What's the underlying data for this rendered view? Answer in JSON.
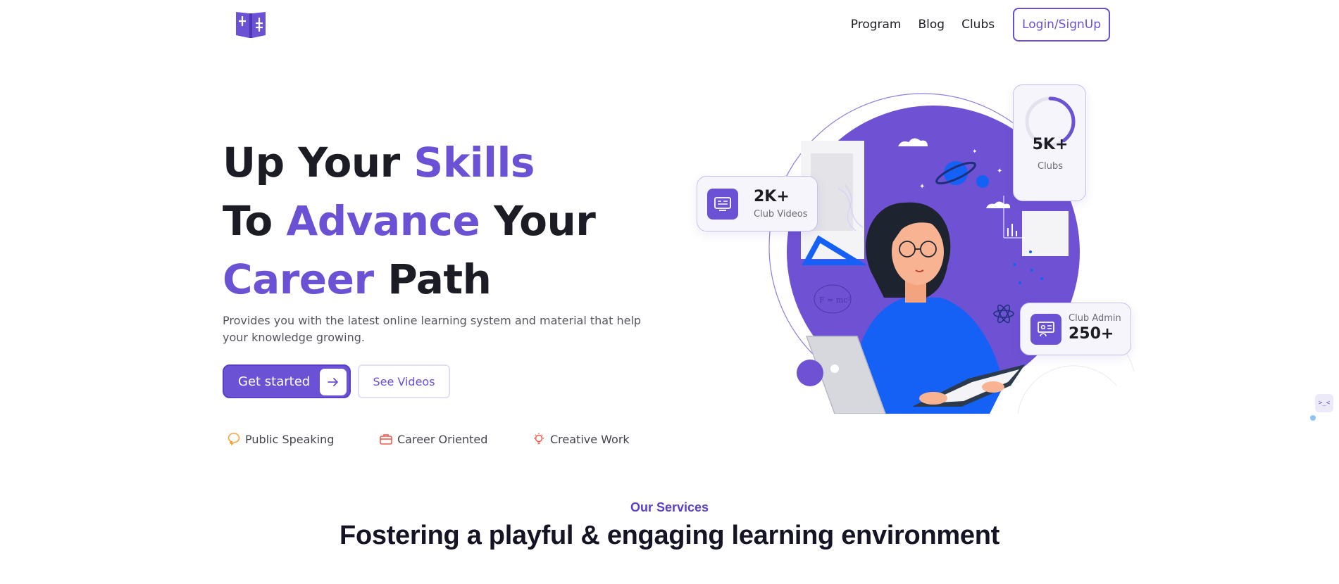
{
  "header": {
    "logo_icon": "open-book-icon",
    "nav": [
      {
        "label": "Program"
      },
      {
        "label": "Blog"
      },
      {
        "label": "Clubs"
      }
    ],
    "login_label": "Login/SignUp"
  },
  "hero": {
    "line1_a": "Up Your ",
    "line1_b": "Skills",
    "line2_a": "To ",
    "line2_b": "Advance",
    "line2_c": " Your",
    "line3_a": "Career",
    "line3_b": " Path",
    "subtext": "Provides you with the latest online learning system and material that help your knowledge growing.",
    "primary_button": "Get started",
    "secondary_button": "See Videos",
    "features": [
      {
        "icon": "speech-bubble-icon",
        "label": "Public Speaking"
      },
      {
        "icon": "briefcase-icon",
        "label": "Career Oriented"
      },
      {
        "icon": "lightbulb-icon",
        "label": "Creative Work"
      }
    ]
  },
  "stats": {
    "videos": {
      "value": "2K+",
      "label": "Club Videos"
    },
    "clubs": {
      "value": "5K+",
      "label": "Clubs",
      "progress_percent": 40
    },
    "admin": {
      "value": "250+",
      "label": "Club Admin"
    }
  },
  "illustration": {
    "formula": "F = mc²"
  },
  "services": {
    "kicker": "Our Services",
    "title": "Fostering a playful & engaging learning environment"
  },
  "widget": {
    "label": ">_<"
  },
  "colors": {
    "brand": "#6b52d4",
    "text": "#1c1c24",
    "accent_blue": "#1560f5",
    "orange": "#f7a440",
    "red": "#f05a4a"
  }
}
